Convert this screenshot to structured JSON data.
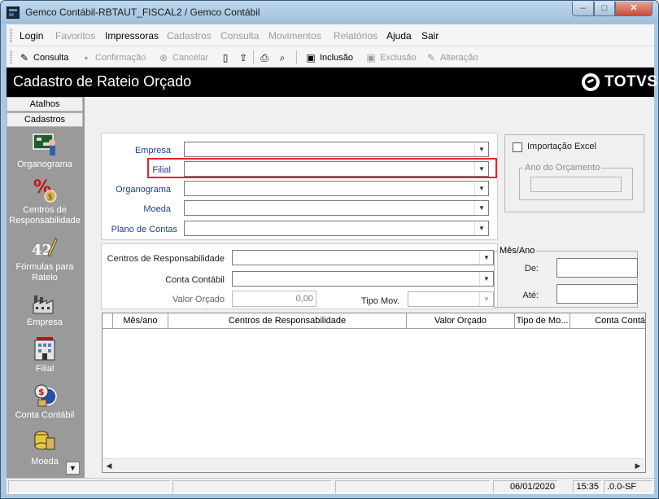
{
  "window": {
    "title": "Gemco Contábil-RBTAUT_FISCAL2 / Gemco Contábil",
    "controls": {
      "minimize": "–",
      "maximize": "□",
      "close": "✕"
    }
  },
  "menu": [
    {
      "label": "Login",
      "enabled": true
    },
    {
      "label": "Favoritos",
      "enabled": false
    },
    {
      "label": "Impressoras",
      "enabled": true
    },
    {
      "label": "Cadastros",
      "enabled": false
    },
    {
      "label": "Consulta",
      "enabled": false
    },
    {
      "label": "Movimentos",
      "enabled": false
    },
    {
      "label": "Relatórios",
      "enabled": false
    },
    {
      "label": "Ajuda",
      "enabled": true
    },
    {
      "label": "Sair",
      "enabled": true
    }
  ],
  "toolbar": {
    "consulta": "Consulta",
    "confirmacao": "Confirmação",
    "cancelar": "Cancelar",
    "inclusao": "Inclusão",
    "exclusao": "Exclusão",
    "alteracao": "Alteração"
  },
  "header": {
    "title": "Cadastro de Rateio Orçado",
    "brand": "TOTVS"
  },
  "sidebar": {
    "tabs": [
      "Atalhos",
      "Cadastros"
    ],
    "items": [
      {
        "label": "Organograma",
        "icon": "organogram-icon"
      },
      {
        "label": "Centros de Responsabilidade",
        "icon": "percent-money-icon"
      },
      {
        "label": "Fórmulas para Rateio",
        "icon": "formula-icon"
      },
      {
        "label": "Empresa",
        "icon": "factory-icon"
      },
      {
        "label": "Filial",
        "icon": "building-icon"
      },
      {
        "label": "Conta Contábil",
        "icon": "account-icon"
      },
      {
        "label": "Moeda",
        "icon": "coins-icon"
      }
    ]
  },
  "form": {
    "empresa_label": "Empresa",
    "filial_label": "Filial",
    "organograma_label": "Organograma",
    "moeda_label": "Moeda",
    "plano_label": "Plano de Contas",
    "importacao_label": "Importação Excel",
    "ano_label": "Ano do Orçamento",
    "centros_label": "Centros de Responsabilidade",
    "conta_label": "Conta Contábil",
    "valor_label": "Valor Orçado",
    "valor_value": "0,00",
    "tipo_label": "Tipo Mov.",
    "mesano_legend": "Mês/Ano",
    "de_label": "De:",
    "ate_label": "Até:"
  },
  "grid": {
    "columns": [
      "Mês/ano",
      "Centros de Responsabilidade",
      "Valor Orçado",
      "Tipo de Mo...",
      "Conta Contá"
    ]
  },
  "status": {
    "date": "06/01/2020",
    "time": "15:35",
    "version": ".0.0-SF"
  },
  "colors": {
    "header_bg": "#000000",
    "highlight": "#e0242b",
    "label_blue": "#1f3e8c",
    "sidebar_bg": "#9a9a9a"
  }
}
